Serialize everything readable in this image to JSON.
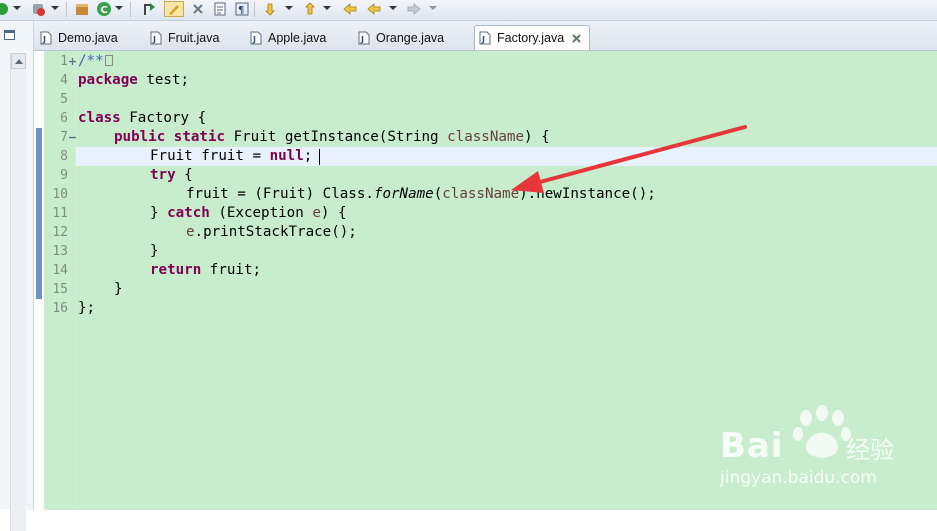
{
  "window": {
    "tabs": [
      {
        "label": "Demo.java",
        "active": false
      },
      {
        "label": "Fruit.java",
        "active": false
      },
      {
        "label": "Apple.java",
        "active": false
      },
      {
        "label": "Orange.java",
        "active": false
      },
      {
        "label": "Factory.java",
        "active": true
      }
    ]
  },
  "editor": {
    "line_numbers": [
      "1",
      "4",
      "5",
      "6",
      "7",
      "8",
      "9",
      "10",
      "11",
      "12",
      "13",
      "14",
      "15",
      "16"
    ],
    "current_line": "8",
    "code": {
      "l1_comment": "/**",
      "l4_kw": "package",
      "l4_rest": " test;",
      "l6_kw": "class",
      "l6_rest": " Factory {",
      "l7_kw": "public static",
      "l7_a": " Fruit getInstance(String ",
      "l7_param": "className",
      "l7_b": ") {",
      "l8_a": "Fruit fruit = ",
      "l8_kw": "null",
      "l8_b": ";",
      "l9_kw": "try",
      "l9_rest": " {",
      "l10_a": "fruit = (Fruit) Class.",
      "l10_it": "forName",
      "l10_b": "(",
      "l10_param": "className",
      "l10_c": ").newInstance();",
      "l11_a": "} ",
      "l11_kw": "catch",
      "l11_b": " (Exception ",
      "l11_param": "e",
      "l11_c": ") {",
      "l12_param": "e",
      "l12_rest": ".printStackTrace();",
      "l13": "}",
      "l14_kw": "return",
      "l14_rest": " fruit;",
      "l15": "}",
      "l16": "};"
    }
  },
  "watermark": {
    "brand": "Bai",
    "brand2": "经验",
    "url": "jingyan.baidu.com"
  },
  "colors": {
    "editor_bg": "#c7edcc",
    "keyword": "#7f0055",
    "comment": "#3f5fbf",
    "parameter": "#6a3e3e",
    "arrow": "#e8373a"
  }
}
